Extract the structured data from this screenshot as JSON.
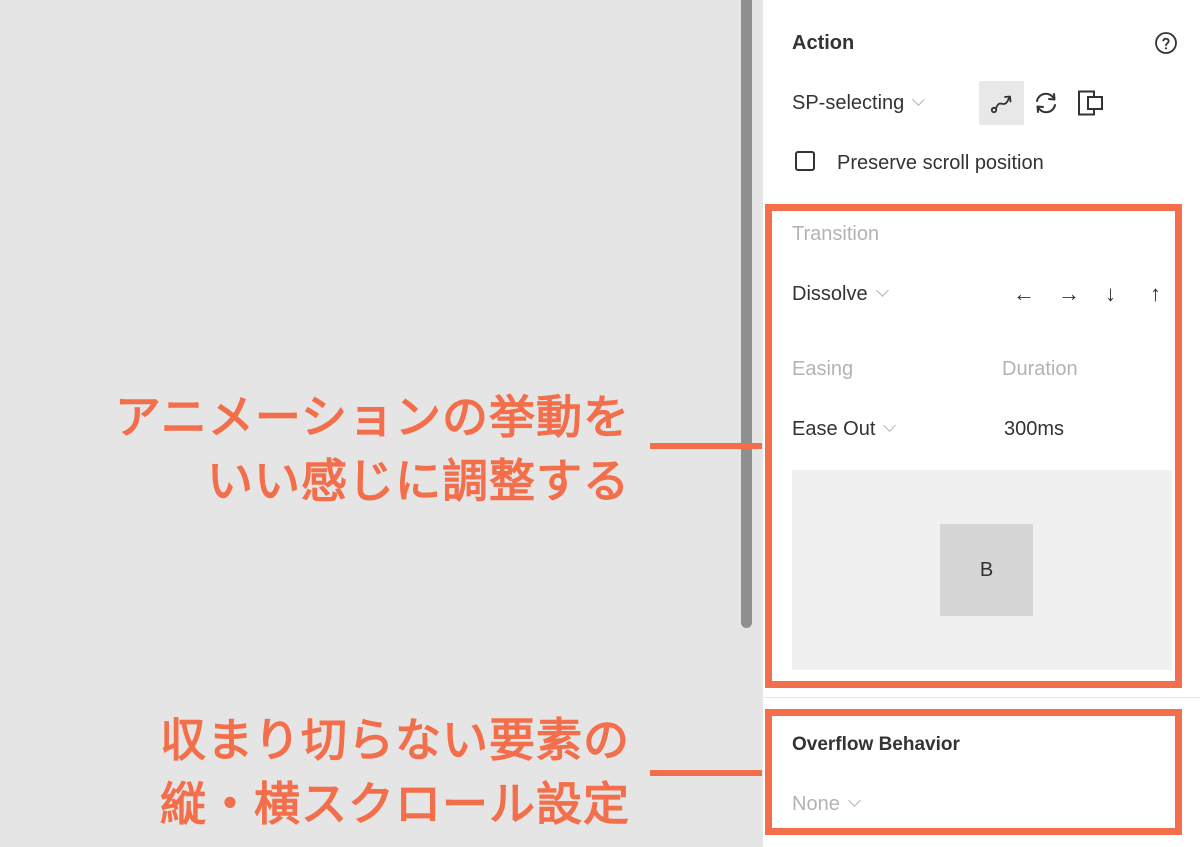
{
  "action": {
    "heading": "Action",
    "destination": "SP-selecting",
    "preserve_scroll_label": "Preserve scroll position",
    "preserve_scroll_checked": false
  },
  "transition": {
    "heading": "Transition",
    "type": "Dissolve",
    "directions": [
      "←",
      "→",
      "↓",
      "↑"
    ],
    "easing_label": "Easing",
    "easing_value": "Ease Out",
    "duration_label": "Duration",
    "duration_value": "300ms",
    "preview_box_label": "B"
  },
  "overflow": {
    "heading": "Overflow Behavior",
    "value": "None"
  },
  "annotations": {
    "animation_line1": "アニメーションの挙動を",
    "animation_line2": "いい感じに調整する",
    "overflow_line1": "収まり切らない要素の",
    "overflow_line2": "縦・横スクロール設定"
  },
  "colors": {
    "annotation": "#f36f4b",
    "canvas": "#e5e5e5"
  },
  "icons": [
    "help-icon",
    "connection-curve-icon",
    "swap-icon",
    "device-frame-icon"
  ]
}
